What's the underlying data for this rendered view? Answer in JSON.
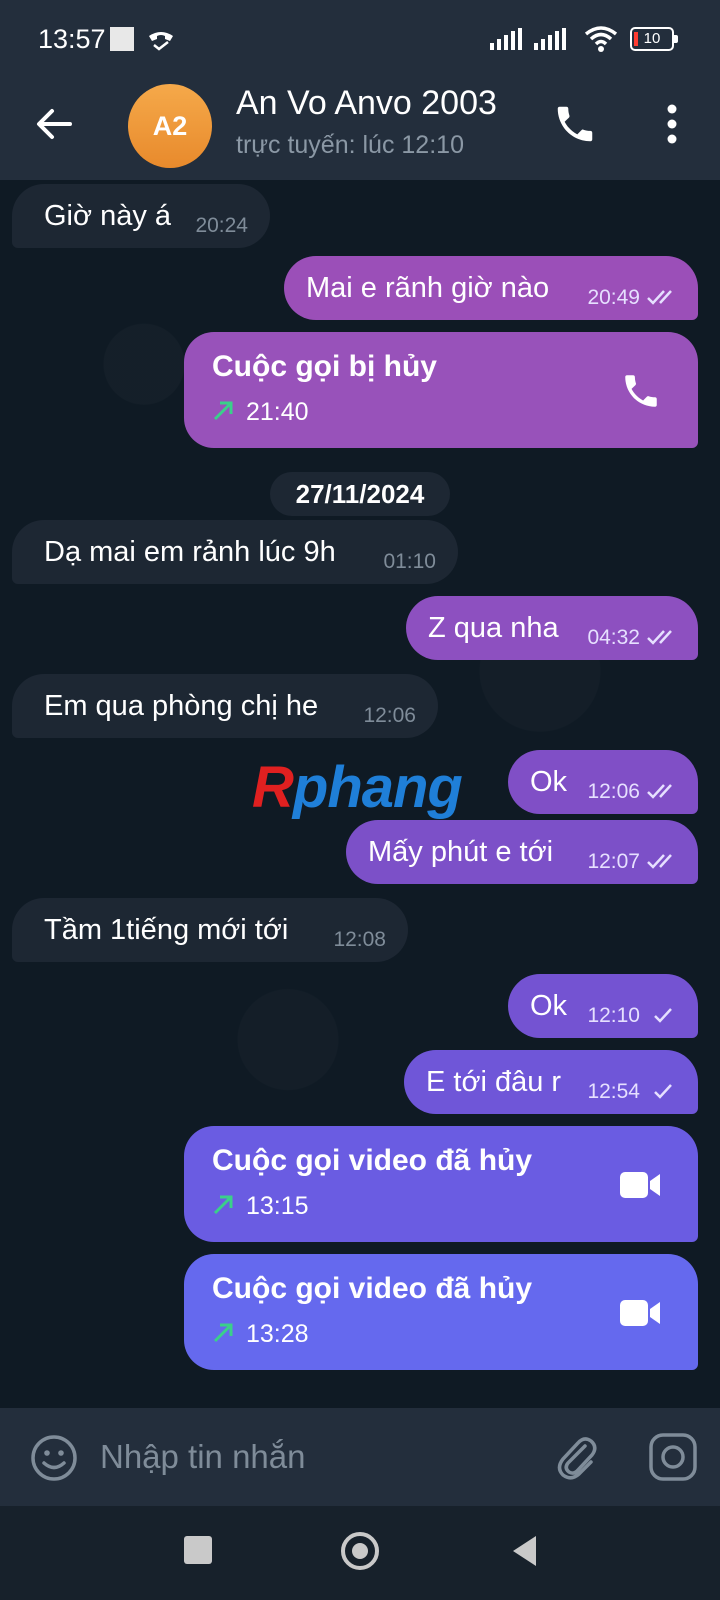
{
  "status_bar": {
    "time": "13:57",
    "battery": "10"
  },
  "header": {
    "avatar_initials": "A2",
    "name": "An Vo Anvo 2003",
    "status": "trực tuyến: lúc 12:10"
  },
  "colors": {
    "avatar": "#f0a040",
    "incoming_bubble": "#1d2733",
    "outgoing_top": "#9b4fb8",
    "outgoing_bottom": "#6b6ef5",
    "call_arrow": "#3ad08a"
  },
  "messages": [
    {
      "dir": "in",
      "text": "Giờ này á",
      "time": "20:24"
    },
    {
      "dir": "out",
      "text": "Mai e rãnh giờ nào",
      "time": "20:49",
      "ticks": "double"
    },
    {
      "type": "call",
      "title": "Cuộc gọi bị hủy",
      "time": "21:40",
      "icon": "phone-icon"
    },
    {
      "type": "date",
      "text": "27/11/2024"
    },
    {
      "dir": "in",
      "text": "Dạ mai em rảnh lúc 9h",
      "time": "01:10"
    },
    {
      "dir": "out",
      "text": "Z qua nha",
      "time": "04:32",
      "ticks": "double"
    },
    {
      "dir": "in",
      "text": "Em qua phòng chị he",
      "time": "12:06"
    },
    {
      "dir": "out",
      "text": "Ok",
      "time": "12:06",
      "ticks": "double"
    },
    {
      "dir": "out",
      "text": "Mấy phút e tới",
      "time": "12:07",
      "ticks": "double"
    },
    {
      "dir": "in",
      "text": "Tầm 1tiếng mới tới",
      "time": "12:08"
    },
    {
      "dir": "out",
      "text": "Ok",
      "time": "12:10",
      "ticks": "single"
    },
    {
      "dir": "out",
      "text": "E tới đâu r",
      "time": "12:54",
      "ticks": "single"
    },
    {
      "type": "call",
      "title": "Cuộc gọi video đã hủy",
      "time": "13:15",
      "icon": "video-icon"
    },
    {
      "type": "call",
      "title": "Cuộc gọi video đã hủy",
      "time": "13:28",
      "icon": "video-icon"
    }
  ],
  "watermark": {
    "first": "R",
    "rest": "phang"
  },
  "input": {
    "placeholder": "Nhập tin nhắn"
  }
}
